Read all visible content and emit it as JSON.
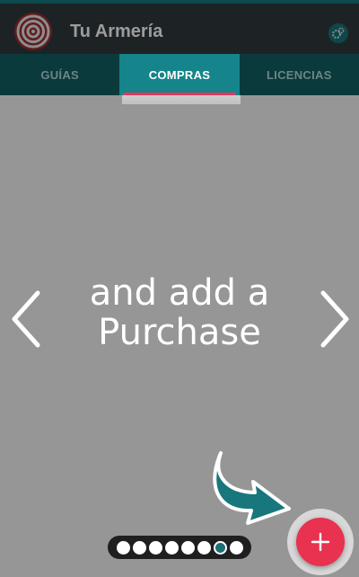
{
  "app": {
    "title": "Tu Armería"
  },
  "icons": {
    "logo": "target-icon",
    "settings": "gears-icon",
    "fab": "plus-icon",
    "prev": "chevron-left-icon",
    "next": "chevron-right-icon",
    "pointer": "curved-arrow-icon"
  },
  "tabs": [
    {
      "label": "GUÍAS",
      "active": false
    },
    {
      "label": "COMPRAS",
      "active": true
    },
    {
      "label": "LICENCIAS",
      "active": false
    }
  ],
  "tutorial": {
    "line1": "and add a",
    "line2": "Purchase",
    "pages_total": 8,
    "current_page": 7
  },
  "colors": {
    "accent": "#15848b",
    "fab": "#e8324f",
    "indicator": "#e4385a"
  }
}
